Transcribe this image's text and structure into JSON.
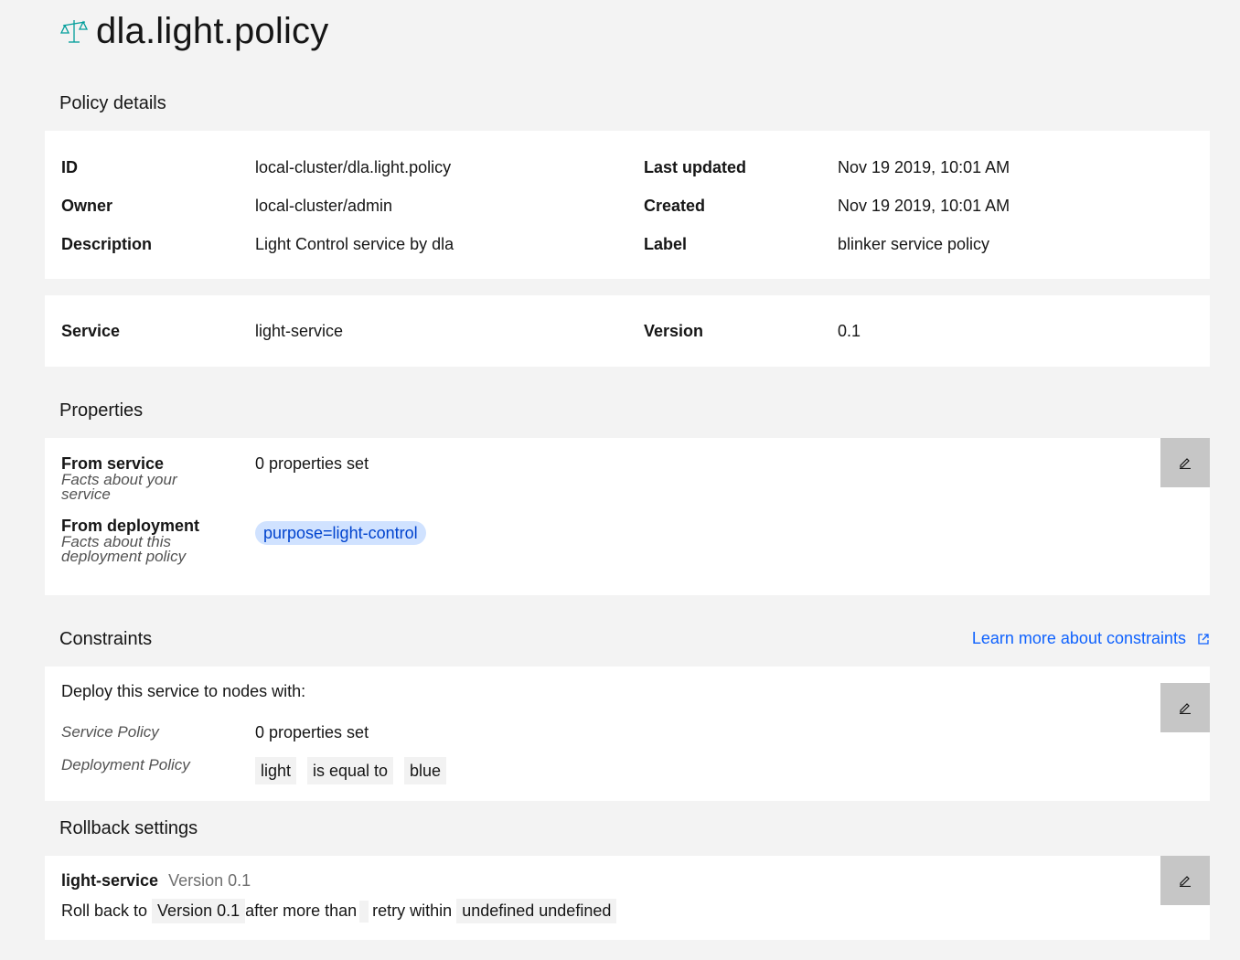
{
  "header": {
    "title": "dla.light.policy",
    "icon": "scale-icon"
  },
  "policy_details": {
    "heading": "Policy details",
    "rows": [
      {
        "label": "ID",
        "value": "local-cluster/dla.light.policy"
      },
      {
        "label": "Owner",
        "value": "local-cluster/admin"
      },
      {
        "label": "Description",
        "value": "Light Control service by dla"
      }
    ],
    "rows_right": [
      {
        "label": "Last updated",
        "value": "Nov 19 2019, 10:01 AM"
      },
      {
        "label": "Created",
        "value": "Nov 19 2019, 10:01 AM"
      },
      {
        "label": "Label",
        "value": "blinker service policy"
      }
    ]
  },
  "service": {
    "service_label": "Service",
    "service_value": "light-service",
    "version_label": "Version",
    "version_value": "0.1"
  },
  "properties": {
    "heading": "Properties",
    "from_service_label": "From service",
    "from_service_sub": "Facts about your service",
    "from_service_value": "0 properties set",
    "from_deployment_label": "From deployment",
    "from_deployment_sub": "Facts about this deployment policy",
    "from_deployment_tag": "purpose=light-control"
  },
  "constraints": {
    "heading": "Constraints",
    "learn_more": "Learn more about constraints",
    "intro": "Deploy this service to nodes with:",
    "service_policy_label": "Service Policy",
    "service_policy_value": "0 properties set",
    "deployment_policy_label": "Deployment Policy",
    "deployment_chips": [
      "light",
      "is equal to",
      "blue"
    ]
  },
  "rollback": {
    "heading": "Rollback settings",
    "service_name": "light-service",
    "version": "Version 0.1",
    "roll_back_to": "Roll back to",
    "target_version": "Version 0.1",
    "after_more_than": "after more than",
    "retry_within": "retry within",
    "duration": "undefined undefined"
  },
  "colors": {
    "accent": "#0f62fe",
    "tag_bg": "#d0e2ff",
    "edit_bg": "#c6c6c6"
  }
}
